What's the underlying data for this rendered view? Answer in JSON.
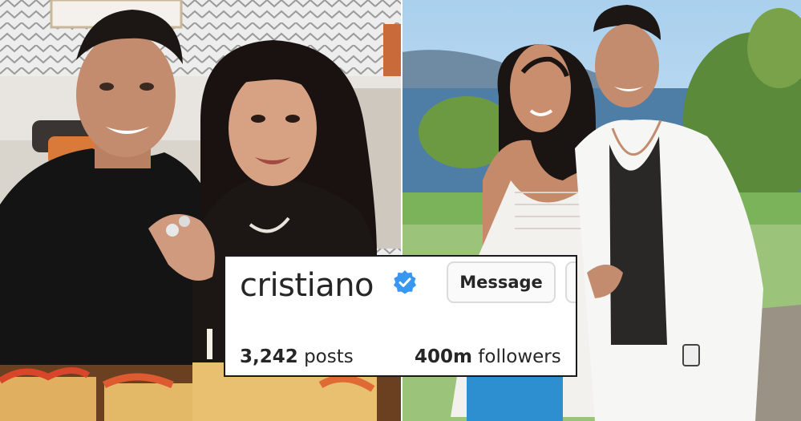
{
  "profile": {
    "username": "cristiano",
    "verified": true,
    "message_button": "Message",
    "posts_count": "3,242",
    "posts_label": "posts",
    "followers_count": "400m",
    "followers_label": "followers"
  },
  "icons": {
    "verified": "verified-badge-icon",
    "more": "more-options-button"
  },
  "colors": {
    "verified_blue": "#3897f0",
    "text": "#262626",
    "button_border": "#dbdbdb"
  }
}
